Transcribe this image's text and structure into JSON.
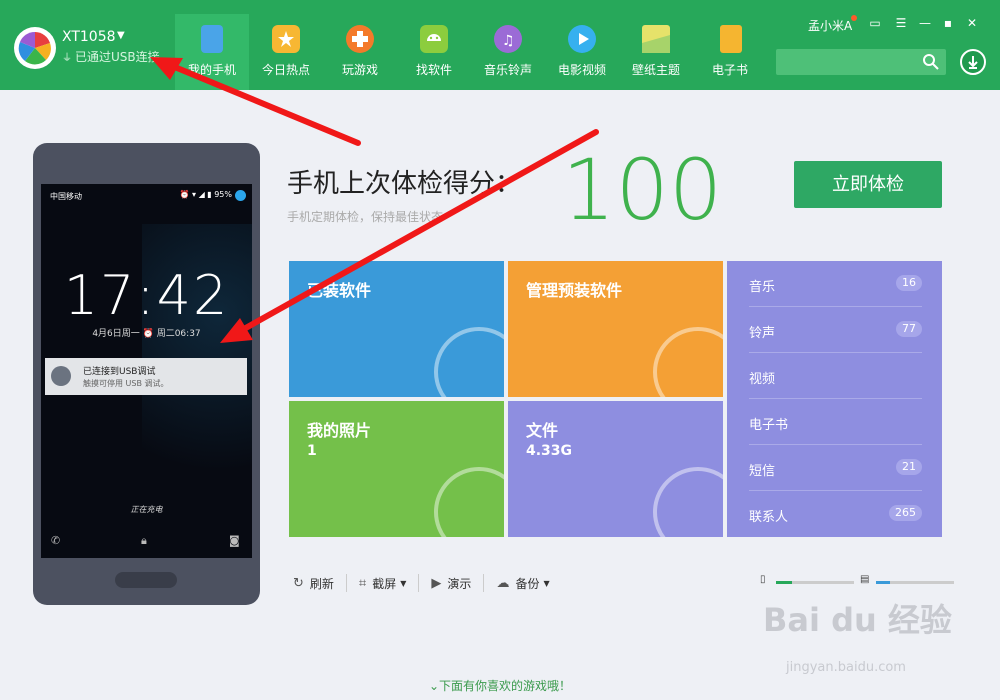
{
  "header": {
    "device_name": "XT1058",
    "usb_status": "已通过USB连接",
    "user_name": "孟小米A",
    "nav": [
      {
        "label": "我的手机",
        "icon": "phone-icon",
        "color": "#4aa4e8"
      },
      {
        "label": "今日热点",
        "icon": "star-icon",
        "color": "#f7b733"
      },
      {
        "label": "玩游戏",
        "icon": "gamepad-icon",
        "color": "#f47a2a"
      },
      {
        "label": "找软件",
        "icon": "android-icon",
        "color": "#8ccd3e"
      },
      {
        "label": "音乐铃声",
        "icon": "music-icon",
        "color": "#9b6bd6"
      },
      {
        "label": "电影视频",
        "icon": "play-icon",
        "color": "#36b0ef"
      },
      {
        "label": "壁纸主题",
        "icon": "wallpaper-icon",
        "color": "#e6e26a"
      },
      {
        "label": "电子书",
        "icon": "book-icon",
        "color": "#f5b530"
      }
    ],
    "search_placeholder": ""
  },
  "phone": {
    "carrier": "中国移动",
    "status_icons": "⏰ ▾ ◢ ▮ 95%",
    "time": "17:42",
    "date": "4月6日周一  ⏰ 周二06:37",
    "notification_title": "已连接到USB调试",
    "notification_sub": "触摸可停用 USB 调试。",
    "charging": "正在充电"
  },
  "checkup": {
    "title": "手机上次体检得分：",
    "subtitle": "手机定期体检，保持最佳状态",
    "score": "100",
    "button": "立即体检"
  },
  "tiles": {
    "installed": {
      "label": "已装软件",
      "color": "#3a9ad9"
    },
    "preinstalled": {
      "label": "管理预装软件",
      "color": "#f4a035"
    },
    "photos": {
      "label": "我的照片",
      "value": "1",
      "color": "#74c04a"
    },
    "files": {
      "label": "文件",
      "value": "4.33G",
      "color": "#8e8ee0"
    }
  },
  "media_list": [
    {
      "label": "音乐",
      "count": "16"
    },
    {
      "label": "铃声",
      "count": "77"
    },
    {
      "label": "视频",
      "count": ""
    },
    {
      "label": "电子书",
      "count": ""
    },
    {
      "label": "短信",
      "count": "21"
    },
    {
      "label": "联系人",
      "count": "265"
    }
  ],
  "toolbar": {
    "refresh": "刷新",
    "screenshot": "截屏",
    "present": "演示",
    "backup": "备份"
  },
  "storage": {
    "phone_used": 0.2,
    "sd_used": 0.18,
    "phone_color": "#27a85a",
    "sd_color": "#3a9ad9"
  },
  "footer": {
    "link": "下面有你喜欢的游戏哦！"
  },
  "watermark": {
    "brand": "Bai du 经验",
    "url": "jingyan.baidu.com"
  }
}
